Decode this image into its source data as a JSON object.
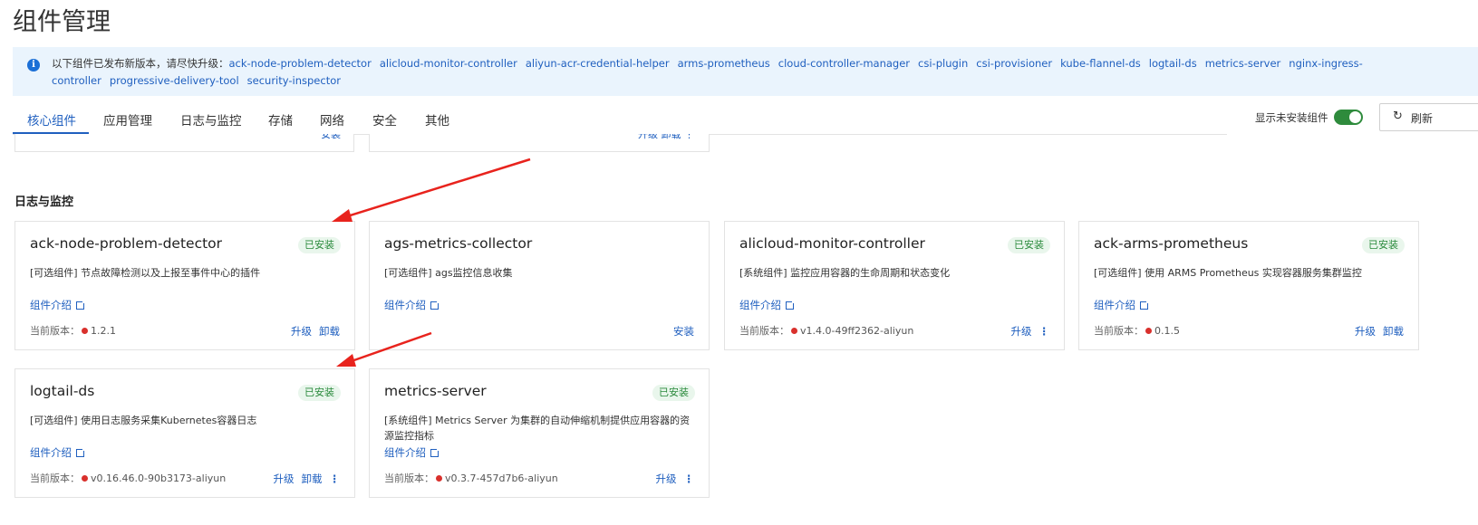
{
  "page": {
    "title": "组件管理"
  },
  "notice": {
    "prefix": "以下组件已发布新版本，请尽快升级：",
    "components": [
      "ack-node-problem-detector",
      "alicloud-monitor-controller",
      "aliyun-acr-credential-helper",
      "arms-prometheus",
      "cloud-controller-manager",
      "csi-plugin",
      "csi-provisioner",
      "kube-flannel-ds",
      "logtail-ds",
      "metrics-server",
      "nginx-ingress-controller",
      "progressive-delivery-tool",
      "security-inspector"
    ]
  },
  "tabs": [
    {
      "label": "核心组件",
      "active": true
    },
    {
      "label": "应用管理",
      "active": false
    },
    {
      "label": "日志与监控",
      "active": false
    },
    {
      "label": "存储",
      "active": false
    },
    {
      "label": "网络",
      "active": false
    },
    {
      "label": "安全",
      "active": false
    },
    {
      "label": "其他",
      "active": false
    }
  ],
  "toolbar": {
    "show_uninstalled_label": "显示未安装组件",
    "show_uninstalled_on": true,
    "refresh_label": "刷新"
  },
  "stub_row": {
    "left_action": "安装",
    "right_actions": "升级  卸载  ⋮"
  },
  "section": {
    "title": "日志与监控"
  },
  "labels": {
    "intro": "组件介绍",
    "version_prefix": "当前版本：",
    "installed": "已安装",
    "upgrade": "升级",
    "uninstall": "卸载",
    "install": "安装"
  },
  "cards": [
    {
      "name": "ack-node-problem-detector",
      "installed": true,
      "tag": "[可选组件]",
      "desc": "节点故障检测以及上报至事件中心的插件",
      "version": "1.2.1",
      "actions": [
        "升级",
        "卸载"
      ],
      "more": false
    },
    {
      "name": "ags-metrics-collector",
      "installed": false,
      "tag": "[可选组件]",
      "desc": "ags监控信息收集",
      "version": "",
      "actions": [
        "安装"
      ],
      "more": false
    },
    {
      "name": "alicloud-monitor-controller",
      "installed": true,
      "tag": "[系统组件]",
      "desc": "监控应用容器的生命周期和状态变化",
      "version": "v1.4.0-49ff2362-aliyun",
      "actions": [
        "升级"
      ],
      "more": true
    },
    {
      "name": "ack-arms-prometheus",
      "installed": true,
      "tag": "[可选组件]",
      "desc": "使用 ARMS Prometheus 实现容器服务集群监控",
      "version": "0.1.5",
      "actions": [
        "升级",
        "卸载"
      ],
      "more": false
    },
    {
      "name": "logtail-ds",
      "installed": true,
      "tag": "[可选组件]",
      "desc": "使用日志服务采集Kubernetes容器日志",
      "version": "v0.16.46.0-90b3173-aliyun",
      "actions": [
        "升级",
        "卸载"
      ],
      "more": true
    },
    {
      "name": "metrics-server",
      "installed": true,
      "tag": "[系统组件]",
      "desc": "Metrics Server 为集群的自动伸缩机制提供应用容器的资源监控指标",
      "version": "v0.3.7-457d7b6-aliyun",
      "actions": [
        "升级"
      ],
      "more": true
    }
  ],
  "colors": {
    "accent": "#1f5fbf",
    "success": "#2a8a3c",
    "danger": "#d9302c",
    "annotation_arrow": "#e8231d"
  }
}
